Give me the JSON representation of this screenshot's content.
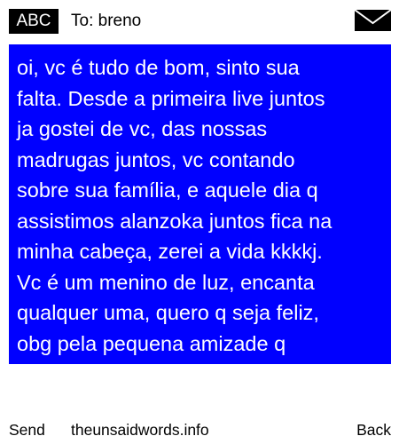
{
  "header": {
    "input_mode": "ABC",
    "recipient": "To: breno"
  },
  "icons": {
    "message_status": "envelope-icon"
  },
  "message": {
    "text": "oi, vc é tudo de bom, sinto sua\nfalta. Desde a primeira live juntos\nja gostei de vc, das nossas\nmadrugas juntos, vc contando\nsobre sua família, e aquele dia q\nassistimos alanzoka juntos fica na\nminha cabeça, zerei a vida kkkkj.\nVc é um menino de luz, encanta\nqualquer uma, quero q seja feliz,\nobg pela pequena amizade q"
  },
  "softkeys": {
    "left": "Send",
    "center": "theunsaidwords.info",
    "right": "Back"
  },
  "colors": {
    "background": "#ffffff",
    "message_bg": "#0000ff",
    "message_text": "#ffffff",
    "mode_badge_bg": "#000000"
  }
}
